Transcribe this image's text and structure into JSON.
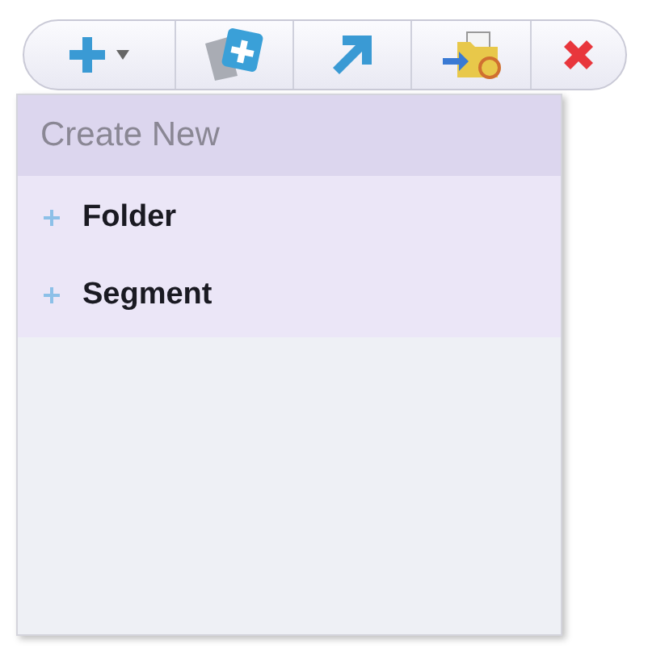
{
  "toolbar": [
    {
      "kind": "add-menu"
    },
    {
      "kind": "new-card"
    },
    {
      "kind": "arrow"
    },
    {
      "kind": "folder-move"
    },
    {
      "kind": "delete"
    }
  ],
  "menu": {
    "header": "Create New",
    "items": [
      {
        "label": "Folder"
      },
      {
        "label": "Segment"
      }
    ]
  }
}
